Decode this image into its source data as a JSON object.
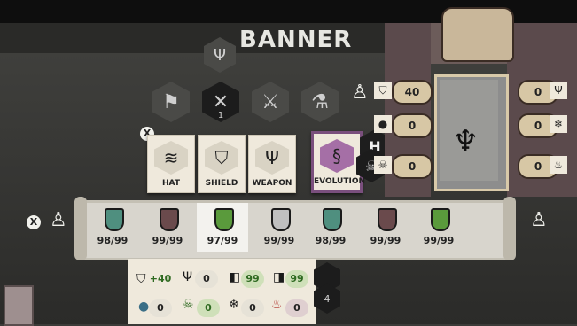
{
  "header": {
    "title": "BANNER"
  },
  "category_icons": [
    {
      "icon": "banner-icon"
    },
    {
      "icon": "crossed-tools-icon",
      "count": "1"
    },
    {
      "icon": "double-axe-icon"
    },
    {
      "icon": "bottle-icon"
    }
  ],
  "hotkey": "H",
  "cards": [
    {
      "label": "HAT",
      "icon": "smoke-icon"
    },
    {
      "label": "SHIELD",
      "icon": "shield-icon"
    },
    {
      "label": "WEAPON",
      "icon": "trident-icon"
    },
    {
      "label": "EVOLUTION",
      "icon": "dna-icon",
      "selected": true
    }
  ],
  "close_glyph": "X",
  "shield_slots": [
    {
      "value": "98/99",
      "color": "#4f8f7f"
    },
    {
      "value": "99/99",
      "color": "#6a4a4c"
    },
    {
      "value": "97/99",
      "color": "#5a9a3c",
      "selected": true
    },
    {
      "value": "99/99",
      "color": "#bfbfbf"
    },
    {
      "value": "98/99",
      "color": "#4f8f7f"
    },
    {
      "value": "99/99",
      "color": "#6a4a4c"
    },
    {
      "value": "99/99",
      "color": "#5a9a3c"
    }
  ],
  "stats": {
    "row1": [
      {
        "icon": "shield-icon",
        "value": "+40",
        "style": "green-text"
      },
      {
        "icon": "trident-icon",
        "value": "0"
      },
      {
        "icon": "cube-icon",
        "value": "99",
        "style": "green"
      },
      {
        "icon": "cubes-icon",
        "value": "99",
        "style": "green"
      }
    ],
    "row2": [
      {
        "icon": "water-drop-icon",
        "value": "0"
      },
      {
        "icon": "skull-crossbones-icon",
        "value": "0",
        "style": "green"
      },
      {
        "icon": "snowflake-icon",
        "value": "0"
      },
      {
        "icon": "fire-icon",
        "value": "0",
        "style": "pink"
      }
    ]
  },
  "idol": {
    "left": [
      {
        "value": "40",
        "icon": "shield-icon"
      },
      {
        "value": "0",
        "icon": "water-drop-icon"
      },
      {
        "value": "0",
        "icon": "skull-crossbones-icon"
      }
    ],
    "right": [
      {
        "value": "0",
        "icon": "trident-icon"
      },
      {
        "value": "0",
        "icon": "snowflake-icon"
      },
      {
        "value": "0",
        "icon": "fire-icon"
      }
    ]
  },
  "partial_hex_count": "4",
  "colors": {
    "selected_card_border": "#7a4f7d",
    "green_stat": "#2f6a21",
    "parchment": "#efe9dc"
  }
}
